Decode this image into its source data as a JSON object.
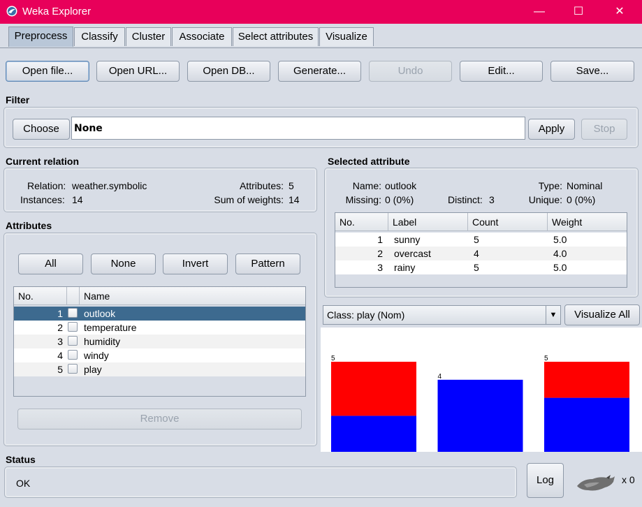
{
  "window": {
    "title": "Weka Explorer",
    "controls": {
      "minimize": "—",
      "maximize": "☐",
      "close": "✕"
    }
  },
  "tabs": [
    "Preprocess",
    "Classify",
    "Cluster",
    "Associate",
    "Select attributes",
    "Visualize"
  ],
  "toolbar": {
    "open_file": "Open file...",
    "open_url": "Open URL...",
    "open_db": "Open DB...",
    "generate": "Generate...",
    "undo": "Undo",
    "edit": "Edit...",
    "save": "Save..."
  },
  "filter": {
    "title": "Filter",
    "choose": "Choose",
    "value": "None",
    "apply": "Apply",
    "stop": "Stop"
  },
  "relation": {
    "title": "Current relation",
    "relation_label": "Relation:",
    "relation_value": "weather.symbolic",
    "instances_label": "Instances:",
    "instances_value": "14",
    "attributes_label": "Attributes:",
    "attributes_value": "5",
    "weights_label": "Sum of weights:",
    "weights_value": "14"
  },
  "attributes": {
    "title": "Attributes",
    "buttons": {
      "all": "All",
      "none": "None",
      "invert": "Invert",
      "pattern": "Pattern"
    },
    "columns": {
      "no": "No.",
      "name": "Name"
    },
    "rows": [
      {
        "no": "1",
        "name": "outlook"
      },
      {
        "no": "2",
        "name": "temperature"
      },
      {
        "no": "3",
        "name": "humidity"
      },
      {
        "no": "4",
        "name": "windy"
      },
      {
        "no": "5",
        "name": "play"
      }
    ],
    "remove": "Remove"
  },
  "selected": {
    "title": "Selected attribute",
    "name_label": "Name:",
    "name_value": "outlook",
    "type_label": "Type:",
    "type_value": "Nominal",
    "missing_label": "Missing:",
    "missing_value": "0 (0%)",
    "distinct_label": "Distinct:",
    "distinct_value": "3",
    "unique_label": "Unique:",
    "unique_value": "0 (0%)",
    "columns": {
      "no": "No.",
      "label": "Label",
      "count": "Count",
      "weight": "Weight"
    },
    "rows": [
      {
        "no": "1",
        "label": "sunny",
        "count": "5",
        "weight": "5.0"
      },
      {
        "no": "2",
        "label": "overcast",
        "count": "4",
        "weight": "4.0"
      },
      {
        "no": "3",
        "label": "rainy",
        "count": "5",
        "weight": "5.0"
      }
    ]
  },
  "class_selector": {
    "value": "Class: play (Nom)",
    "visualize_all": "Visualize All"
  },
  "chart_data": {
    "type": "bar",
    "categories": [
      "sunny",
      "overcast",
      "rainy"
    ],
    "series": [
      {
        "name": "",
        "color": "#0000ff",
        "values": [
          2,
          4,
          3
        ]
      },
      {
        "name": "",
        "color": "#ff0000",
        "values": [
          3,
          0,
          2
        ]
      }
    ],
    "totals": [
      "5",
      "4",
      "5"
    ],
    "ylim": [
      0,
      5
    ]
  },
  "status": {
    "title": "Status",
    "text": "OK",
    "log": "Log",
    "count": "x 0"
  },
  "colors": {
    "titlebar": "#e8005a",
    "selection": "#3d6a8f",
    "bar_blue": "#0000ff",
    "bar_red": "#ff0000"
  }
}
